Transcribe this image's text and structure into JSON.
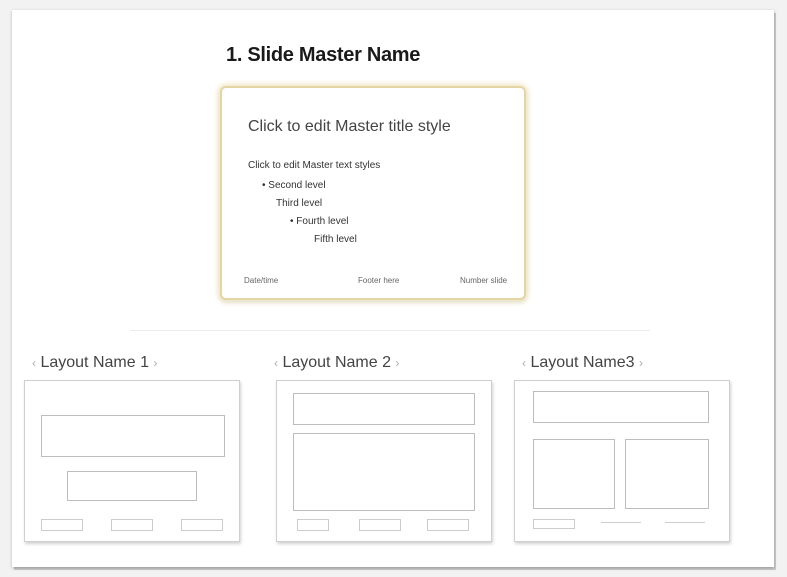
{
  "master": {
    "name": "1.  Slide Master Name",
    "title_placeholder": "Click to edit Master title style",
    "text_levels": [
      "Click to edit Master text styles",
      "• Second level",
      "Third level",
      "• Fourth level",
      "Fifth level"
    ],
    "footer_left": "Date/time",
    "footer_center": "Footer here",
    "footer_right": "Number slide"
  },
  "layouts": [
    {
      "name": "Layout Name 1"
    },
    {
      "name": "Layout Name 2"
    },
    {
      "name": "Layout Name3"
    }
  ],
  "brackets": {
    "open": "‹",
    "close": "›"
  }
}
